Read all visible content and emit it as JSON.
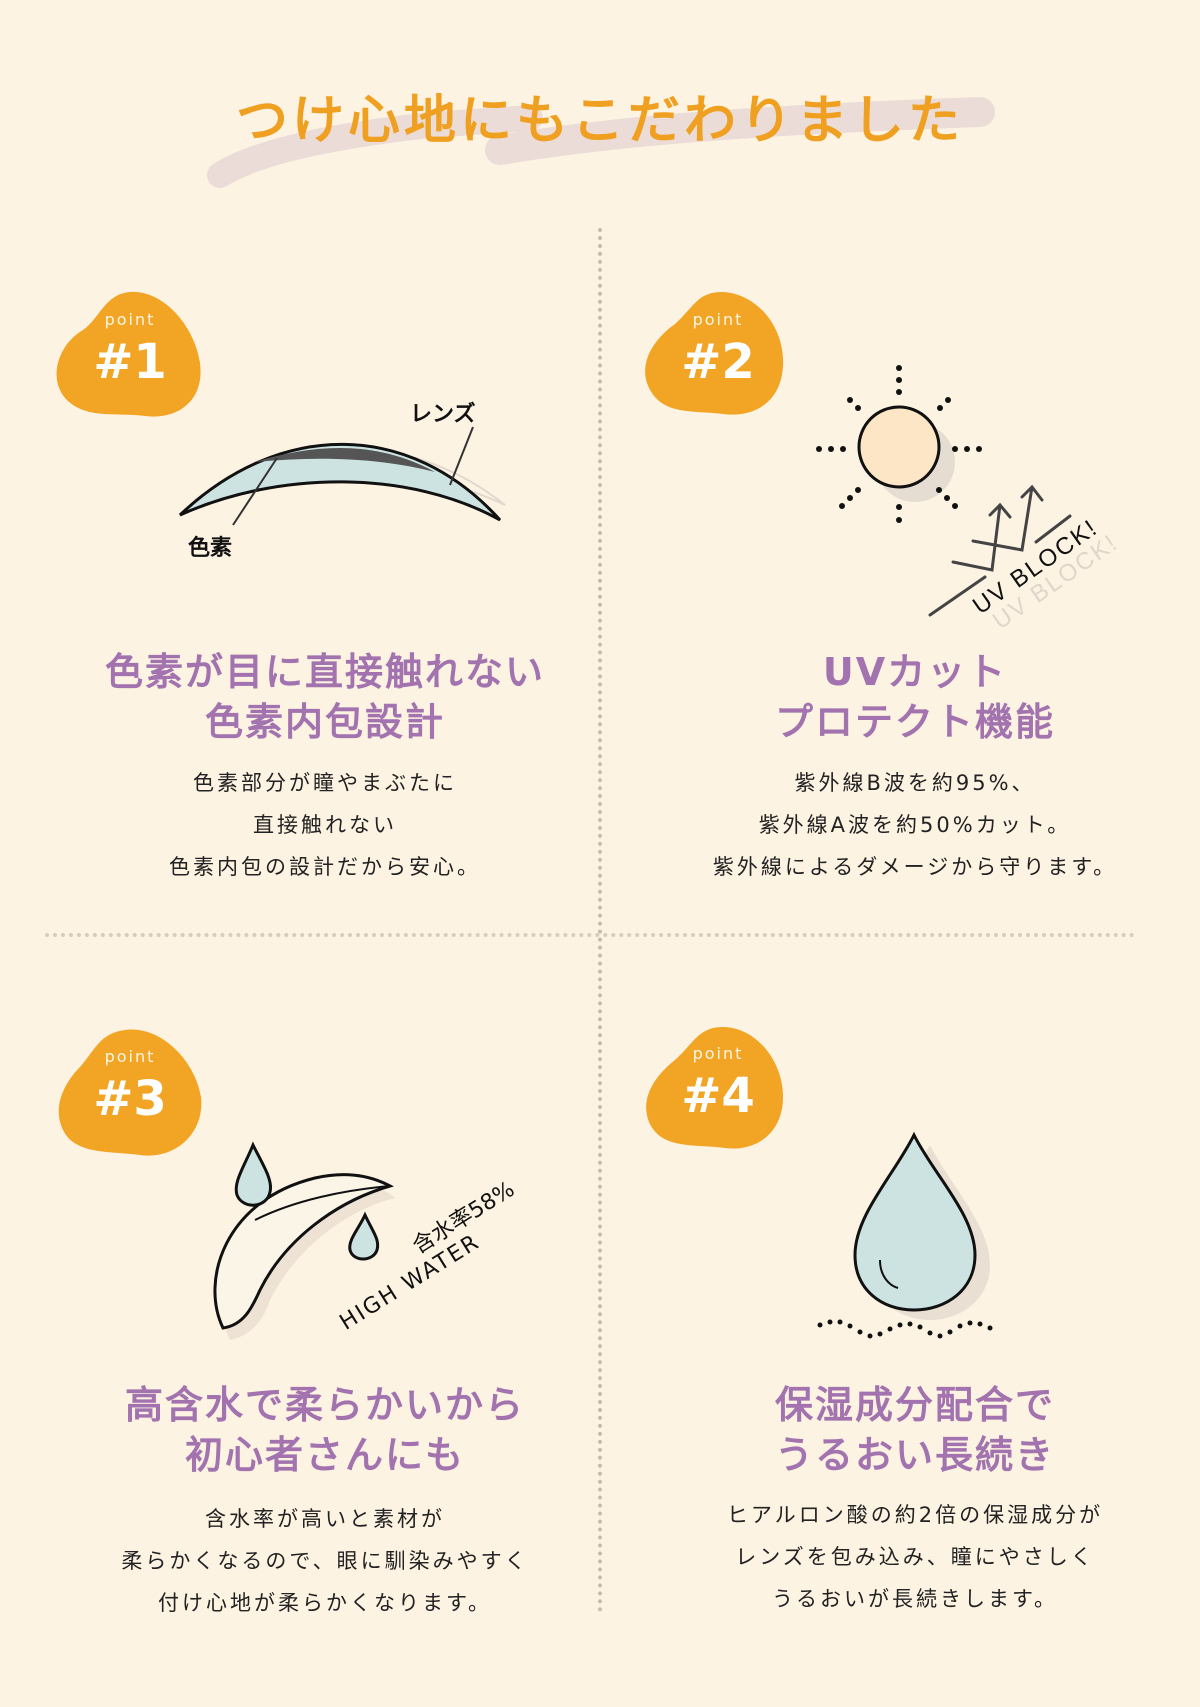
{
  "header": {
    "title": "つけ心地にもこだわりました"
  },
  "colors": {
    "background": "#FDF3E2",
    "accent_orange": "#F2A424",
    "heading_purple": "#A273AE",
    "lens_blue": "#CDE3E1"
  },
  "points": [
    {
      "badge_label": "point",
      "badge_number": "#1",
      "illustration": {
        "icon": "lens-cross-section",
        "labels": [
          "レンズ",
          "色素"
        ]
      },
      "title_lines": [
        "色素が目に直接触れない",
        "色素内包設計"
      ],
      "body_lines": [
        "色素部分が瞳やまぶたに",
        "直接触れない",
        "色素内包の設計だから安心。"
      ]
    },
    {
      "badge_label": "point",
      "badge_number": "#2",
      "illustration": {
        "icon": "sun-uv-block",
        "labels": [
          "UV BLOCK!"
        ]
      },
      "title_lines": [
        "UVカット",
        "プロテクト機能"
      ],
      "body_lines": [
        "紫外線B波を約95%、",
        "紫外線A波を約50%カット。",
        "紫外線によるダメージから守ります。"
      ]
    },
    {
      "badge_label": "point",
      "badge_number": "#3",
      "illustration": {
        "icon": "lens-water-drops",
        "labels": [
          "含水率58%",
          "HIGH WATER"
        ]
      },
      "title_lines": [
        "高含水で柔らかいから",
        "初心者さんにも"
      ],
      "body_lines": [
        "含水率が高いと素材が",
        "柔らかくなるので、眼に馴染みやすく",
        "付け心地が柔らかくなります。"
      ]
    },
    {
      "badge_label": "point",
      "badge_number": "#4",
      "illustration": {
        "icon": "moisture-drop"
      },
      "title_lines": [
        "保湿成分配合で",
        "うるおい長続き"
      ],
      "body_lines": [
        "ヒアルロン酸の約2倍の保湿成分が",
        "レンズを包み込み、瞳にやさしく",
        "うるおいが長続きします。"
      ]
    }
  ]
}
